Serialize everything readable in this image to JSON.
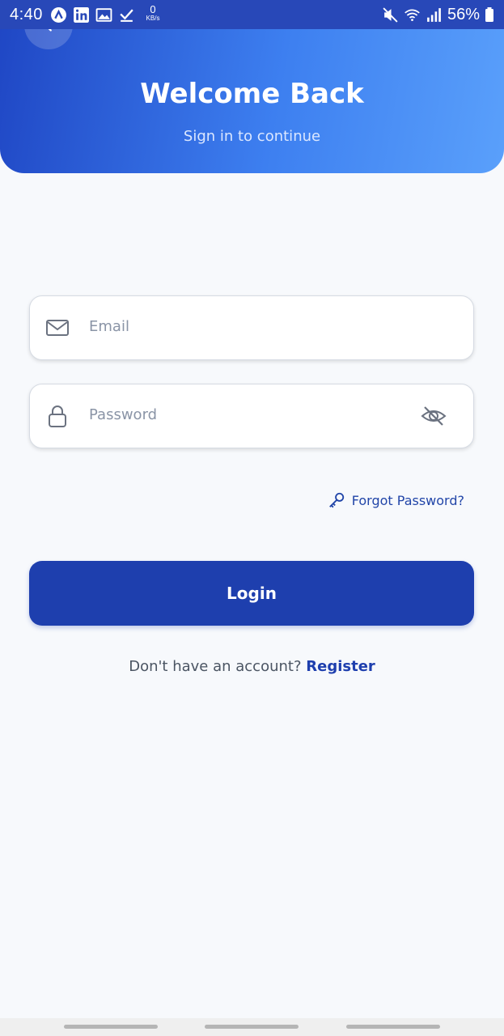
{
  "status_bar": {
    "time": "4:40",
    "data_rate_value": "0",
    "data_rate_unit": "KB/s",
    "battery": "56%",
    "icons": [
      "app-icon",
      "linkedin-icon",
      "gallery-icon",
      "download-done-icon",
      "mute-icon",
      "wifi-icon",
      "signal-icon",
      "battery-icon"
    ]
  },
  "header": {
    "title": "Welcome Back",
    "subtitle": "Sign in to continue"
  },
  "form": {
    "email_placeholder": "Email",
    "password_placeholder": "Password",
    "forgot_password": "Forgot Password?",
    "login_label": "Login"
  },
  "footer": {
    "prompt": "Don't have an account?",
    "register_link": "Register"
  },
  "colors": {
    "primary": "#1e3fae",
    "header_gradient_start": "#1f46c4",
    "header_gradient_end": "#5aa0fb",
    "background": "#f7f9fc"
  }
}
